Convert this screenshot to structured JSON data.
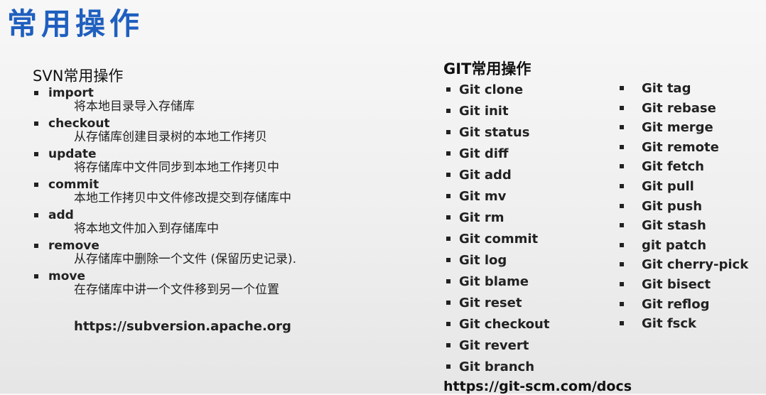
{
  "title": "常用操作",
  "svn": {
    "heading": "SVN常用操作",
    "items": [
      {
        "cmd": "import",
        "desc": "将本地目录导入存储库"
      },
      {
        "cmd": "checkout",
        "desc": "从存储库创建目录树的本地工作拷贝"
      },
      {
        "cmd": "update",
        "desc": "将存储库中文件同步到本地工作拷贝中"
      },
      {
        "cmd": "commit",
        "desc": "本地工作拷贝中文件修改提交到存储库中"
      },
      {
        "cmd": "add",
        "desc": "将本地文件加入到存储库中"
      },
      {
        "cmd": "remove",
        "desc": "从存储库中删除一个文件 (保留历史记录)."
      },
      {
        "cmd": "move",
        "desc": "在存储库中讲一个文件移到另一个位置"
      }
    ],
    "url": "https://subversion.apache.org"
  },
  "git": {
    "heading": "GIT常用操作",
    "col1": [
      "Git clone",
      "Git init",
      "Git status",
      "Git diff",
      "Git add",
      "Git mv",
      "Git rm",
      "Git commit",
      "Git log",
      "Git blame",
      "Git reset",
      "Git checkout",
      "Git revert",
      "Git branch"
    ],
    "col2": [
      "Git tag",
      "Git rebase",
      "Git merge",
      "Git remote",
      "Git fetch",
      "Git pull",
      "Git push",
      "Git stash",
      "git patch",
      "Git cherry-pick",
      "Git bisect",
      "Git reflog",
      "Git fsck"
    ],
    "url": "https://git-scm.com/docs"
  }
}
